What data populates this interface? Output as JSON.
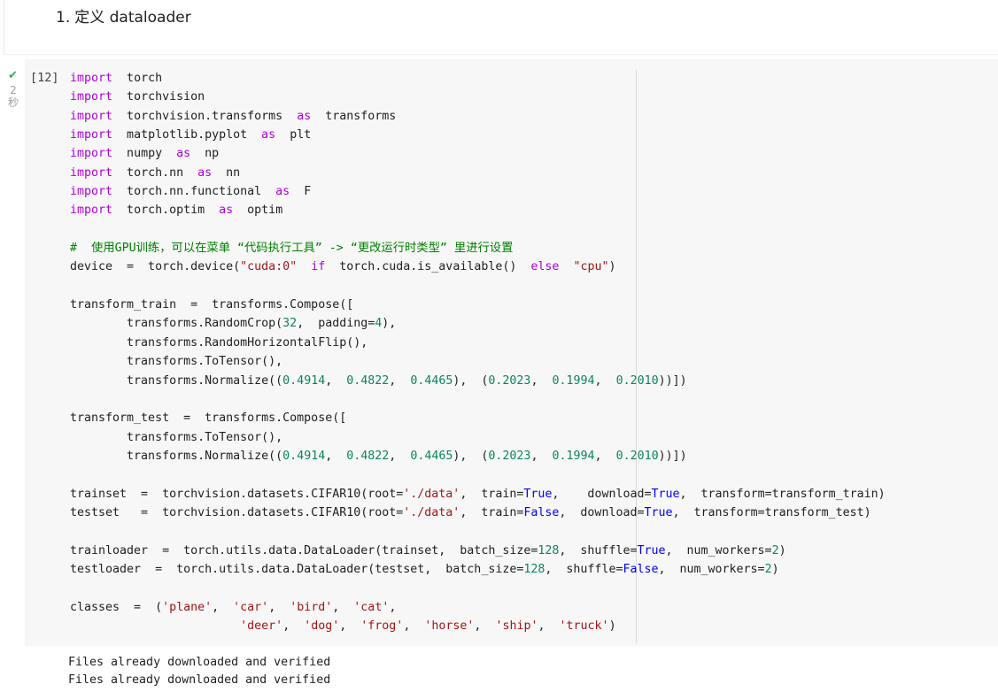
{
  "markdown_cell": {
    "number": "1.",
    "heading": "定义 dataloader"
  },
  "code_cell": {
    "status_icon": "check-icon",
    "status_color": "#34a853",
    "run_time_number": "2",
    "run_time_unit": "秒",
    "execution_count": "[12]",
    "code_lines": [
      "import  torch",
      "import  torchvision",
      "import  torchvision.transforms  as  transforms",
      "import  matplotlib.pyplot  as  plt",
      "import  numpy  as  np",
      "import  torch.nn  as  nn",
      "import  torch.nn.functional  as  F",
      "import  torch.optim  as  optim",
      "",
      "#  使用GPU训练，可以在菜单 “代码执行工具” -> “更改运行时类型” 里进行设置",
      "device  =  torch.device(\"cuda:0\"  if  torch.cuda.is_available()  else  \"cpu\")",
      "",
      "transform_train  =  transforms.Compose([",
      "        transforms.RandomCrop(32,  padding=4),",
      "        transforms.RandomHorizontalFlip(),",
      "        transforms.ToTensor(),",
      "        transforms.Normalize((0.4914,  0.4822,  0.4465),  (0.2023,  0.1994,  0.2010))])",
      "",
      "transform_test  =  transforms.Compose([",
      "        transforms.ToTensor(),",
      "        transforms.Normalize((0.4914,  0.4822,  0.4465),  (0.2023,  0.1994,  0.2010))])",
      "",
      "trainset  =  torchvision.datasets.CIFAR10(root='./data',  train=True,    download=True,  transform=transform_train)",
      "testset   =  torchvision.datasets.CIFAR10(root='./data',  train=False,  download=True,  transform=transform_test)",
      "",
      "trainloader  =  torch.utils.data.DataLoader(trainset,  batch_size=128,  shuffle=True,  num_workers=2)",
      "testloader  =  torch.utils.data.DataLoader(testset,  batch_size=128,  shuffle=False,  num_workers=2)",
      "",
      "classes  =  ('plane',  'car',  'bird',  'cat',",
      "                        'deer',  'dog',  'frog',  'horse',  'ship',  'truck')"
    ],
    "syntax_colors": {
      "keyword": "#af00db",
      "string": "#a31515",
      "number": "#098658",
      "boolean": "#0000ff",
      "comment": "#008000"
    }
  },
  "output": {
    "lines": [
      "Files already downloaded and verified",
      "Files already downloaded and verified"
    ]
  }
}
